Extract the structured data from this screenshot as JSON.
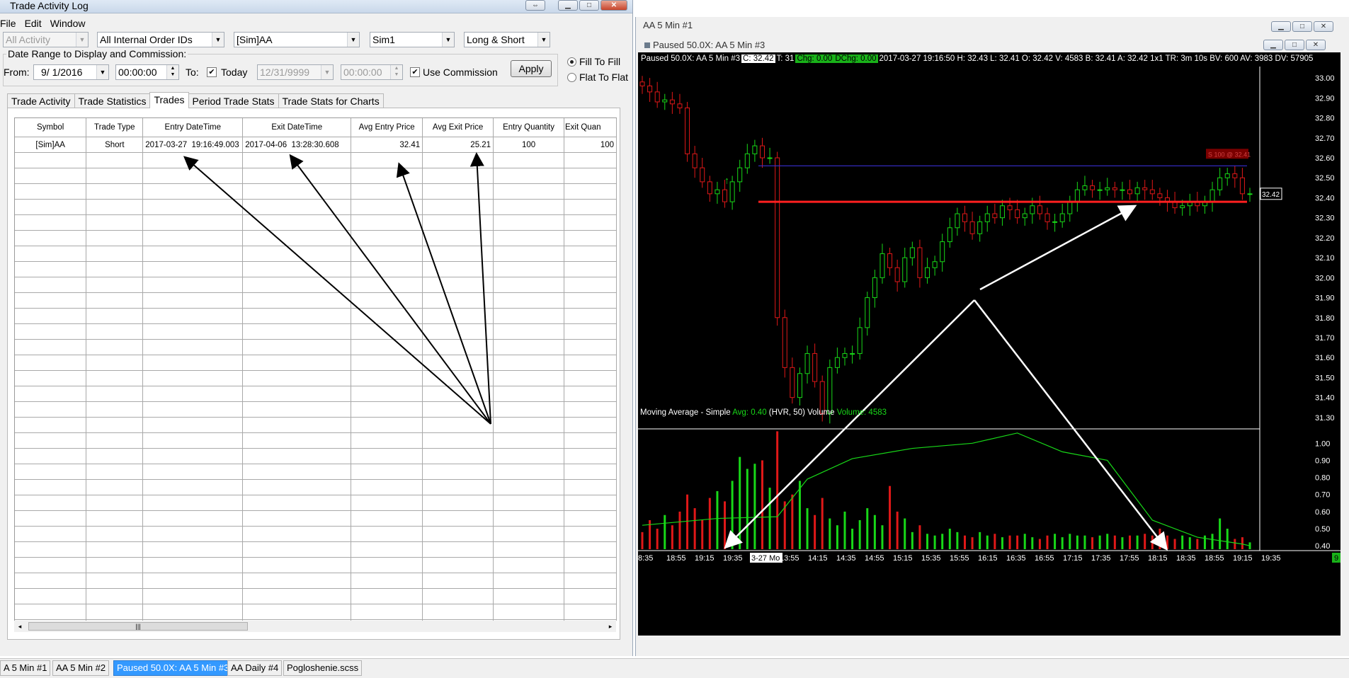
{
  "trade_log": {
    "title": "Trade Activity Log",
    "menu": [
      "File",
      "Edit",
      "Window"
    ],
    "filters": {
      "activity": "All Activity",
      "order_ids": "All Internal Order IDs",
      "instrument": "[Sim]AA",
      "account": "Sim1",
      "direction": "Long & Short"
    },
    "date_range": {
      "legend": "Date Range to Display and Commission:",
      "from_label": "From:",
      "from_date": "9/ 1/2016",
      "from_time": "00:00:00",
      "to_label": "To:",
      "today_label": "Today",
      "today_checked": true,
      "to_date": "12/31/9999",
      "to_time": "00:00:00",
      "use_commission_label": "Use Commission",
      "use_commission_checked": true,
      "apply_label": "Apply"
    },
    "fill_options": {
      "fill_to_fill": "Fill To Fill",
      "flat_to_flat": "Flat To Flat",
      "selected": "fill_to_fill"
    },
    "tabs": [
      "Trade Activity",
      "Trade Statistics",
      "Trades",
      "Period Trade Stats",
      "Trade Stats for Charts"
    ],
    "active_tab": "Trades",
    "columns": [
      "Symbol",
      "Trade Type",
      "Entry DateTime",
      "Exit DateTime",
      "Avg Entry Price",
      "Avg Exit Price",
      "Entry Quantity",
      "Exit Quan"
    ],
    "rows": [
      {
        "symbol": "[Sim]AA",
        "trade_type": "Short",
        "entry_datetime": "2017-03-27  19:16:49.003",
        "exit_datetime": "2017-04-06  13:28:30.608",
        "avg_entry_price": "32.41",
        "avg_exit_price": "25.21",
        "entry_quantity": "100",
        "exit_quantity": "100"
      }
    ]
  },
  "chart_window": {
    "outer_title": "AA  5 Min  #1",
    "title": "Paused 50.0X: AA  5 Min  #3",
    "info": {
      "label": "Paused 50.0X: AA  5 Min  #3",
      "close": "C: 32.42",
      "trades": "T: 31",
      "chg": "Chg: 0.00",
      "dchg": "DChg: 0.00",
      "rest": "2017-03-27 19:16:50  H: 32.43  L: 32.41  O: 32.42  V: 4583  B: 32.41  A: 32.42 1x1  TR: 3m 10s  BV: 600  AV: 3983  DV: 57905"
    },
    "price_tag": "32.42",
    "order_label": "S 100 @ 32.41",
    "indicator_label": "Moving Average - Simple",
    "indicator_avg": "Avg: 0.40",
    "indicator_params": "(HVR, 50)  Volume",
    "indicator_volume": "Volume: 4583",
    "scroll_badge": "9",
    "colors": {
      "up": "#18d818",
      "down": "#e01818",
      "order_line": "#ff2020",
      "level_line": "#3a2fd0",
      "ma_line": "#18d818",
      "background": "#000000"
    }
  },
  "chart_data": [
    {
      "type": "candlestick",
      "title": "Paused 50.0X: AA  5 Min  #3",
      "xlabel": "",
      "ylabel": "",
      "x_ticks": [
        "8:35",
        "18:55",
        "19:15",
        "19:35",
        "3-27 Mo",
        "13:55",
        "14:15",
        "14:35",
        "14:55",
        "15:15",
        "15:35",
        "15:55",
        "16:15",
        "16:35",
        "16:55",
        "17:15",
        "17:35",
        "17:55",
        "18:15",
        "18:35",
        "18:55",
        "19:15",
        "19:35"
      ],
      "y_ticks": [
        "33.00",
        "32.90",
        "32.80",
        "32.70",
        "32.60",
        "32.50",
        "32.40",
        "32.30",
        "32.20",
        "32.10",
        "32.00",
        "31.90",
        "31.80",
        "31.70",
        "31.60",
        "31.50",
        "31.40",
        "31.30"
      ],
      "ylim": [
        31.25,
        33.05
      ],
      "horizontal_lines": [
        {
          "label": "order",
          "value": 32.38,
          "color": "#ff2020"
        },
        {
          "label": "level",
          "value": 32.56,
          "color": "#3a2fd0"
        }
      ],
      "close_series": [
        32.96,
        32.93,
        32.88,
        32.89,
        32.87,
        32.85,
        32.62,
        32.55,
        32.48,
        32.42,
        32.44,
        32.38,
        32.48,
        32.55,
        32.62,
        32.66,
        32.6,
        32.6,
        31.8,
        31.55,
        31.4,
        31.52,
        31.62,
        31.48,
        31.32,
        31.55,
        31.6,
        31.62,
        31.62,
        31.75,
        31.9,
        32.0,
        32.12,
        32.05,
        31.98,
        32.1,
        32.15,
        32.0,
        32.05,
        32.08,
        32.18,
        32.25,
        32.32,
        32.28,
        32.22,
        32.28,
        32.32,
        32.3,
        32.36,
        32.34,
        32.3,
        32.32,
        32.36,
        32.32,
        32.28,
        32.28,
        32.32,
        32.38,
        32.44,
        32.46,
        32.44,
        32.44,
        32.45,
        32.44,
        32.44,
        32.42,
        32.45,
        32.44,
        32.42,
        32.4,
        32.38,
        32.35,
        32.36,
        32.38,
        32.36,
        32.38,
        32.44,
        32.5,
        32.52,
        32.5,
        32.42,
        32.42
      ]
    },
    {
      "type": "bar",
      "title": "Moving Average - Simple",
      "y_ticks": [
        "1.00",
        "0.90",
        "0.80",
        "0.70",
        "0.60",
        "0.50",
        "0.40"
      ],
      "ylim": [
        0.38,
        1.08
      ],
      "series": [
        {
          "name": "Volume",
          "values": [
            0.48,
            0.55,
            0.5,
            0.58,
            0.52,
            0.6,
            0.7,
            0.62,
            0.55,
            0.68,
            0.72,
            0.66,
            0.78,
            0.92,
            0.85,
            0.88,
            0.9,
            0.74,
            1.07,
            0.66,
            0.7,
            0.78,
            0.62,
            0.58,
            0.68,
            0.56,
            0.52,
            0.6,
            0.5,
            0.55,
            0.62,
            0.58,
            0.52,
            0.75,
            0.6,
            0.56,
            0.48,
            0.52,
            0.47,
            0.46,
            0.47,
            0.5,
            0.48,
            0.46,
            0.45,
            0.48,
            0.46,
            0.47,
            0.45,
            0.46,
            0.46,
            0.47,
            0.45,
            0.44,
            0.46,
            0.47,
            0.45,
            0.47,
            0.46,
            0.46,
            0.45,
            0.46,
            0.47,
            0.46,
            0.45,
            0.46,
            0.46,
            0.47,
            0.46,
            0.5,
            0.46,
            0.44,
            0.46,
            0.45,
            0.44,
            0.46,
            0.47,
            0.56,
            0.5,
            0.44,
            0.45,
            0.42
          ]
        },
        {
          "name": "Avg",
          "x": [
            0,
            10,
            18,
            22,
            28,
            36,
            44,
            50,
            56,
            62,
            68,
            74,
            80,
            81
          ],
          "values": [
            0.52,
            0.56,
            0.57,
            0.79,
            0.91,
            0.97,
            1.0,
            1.06,
            0.95,
            0.9,
            0.55,
            0.45,
            0.41,
            0.4
          ]
        }
      ]
    }
  ],
  "annotations": {
    "left_arrows_target_labels": [
      "Entry DateTime",
      "Exit DateTime",
      "Avg Entry Price",
      "Avg Exit Price"
    ],
    "right_arrows": "chart entry and exit points"
  },
  "taskbar": [
    "A  5 Min  #1",
    "AA  5 Min  #2",
    "Paused 50.0X: AA  5 Min  #3",
    "AA  Daily  #4",
    "Pogloshenie.scss"
  ],
  "taskbar_active": 2
}
